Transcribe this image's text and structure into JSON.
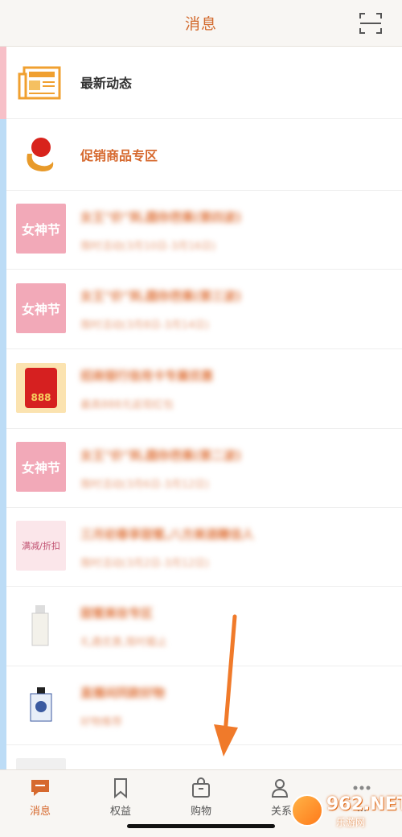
{
  "header": {
    "title": "消息"
  },
  "list": {
    "items": [
      {
        "title": "最新动态"
      },
      {
        "title": "促销商品专区"
      },
      {
        "title": "女王\"价\"到,圆你芭蕉(第四波)",
        "subtitle": "限时活动(3月10日-3月16日)",
        "thumb_text": "女神节"
      },
      {
        "title": "女王\"价\"到,圆你芭蕉(第三波)",
        "subtitle": "限时活动(3月8日-3月14日)",
        "thumb_text": "女神节"
      },
      {
        "title": "招商银行信用卡专属优惠",
        "subtitle": "最高888元返现红包",
        "thumb_text": "888"
      },
      {
        "title": "女王\"价\"到,圆你芭蕉(第二波)",
        "subtitle": "限时活动(3月6日-3月12日)",
        "thumb_text": "女神节"
      },
      {
        "title": "三月初春享甜蜜,八方美酒赠佳人",
        "subtitle": "限时活动(3月2日-3月12日)",
        "thumb_text": "满减/折扣"
      },
      {
        "title": "甜蜜美妆专区",
        "subtitle": "礼遇优惠,限时截止"
      },
      {
        "title": "直播间同款好物",
        "subtitle": "好物推荐"
      }
    ]
  },
  "tabs": [
    {
      "label": "消息",
      "icon": "message-icon"
    },
    {
      "label": "权益",
      "icon": "bookmark-icon"
    },
    {
      "label": "购物",
      "icon": "shopping-bag-icon"
    },
    {
      "label": "关系",
      "icon": "people-icon"
    },
    {
      "label": "...",
      "icon": "more-icon"
    }
  ],
  "watermark": {
    "brand": "962.NET",
    "sub": "乐游网"
  },
  "colors": {
    "accent": "#d6692e",
    "blue_bar": "#bcdcf6",
    "pink_bar": "#f7c0c8"
  }
}
